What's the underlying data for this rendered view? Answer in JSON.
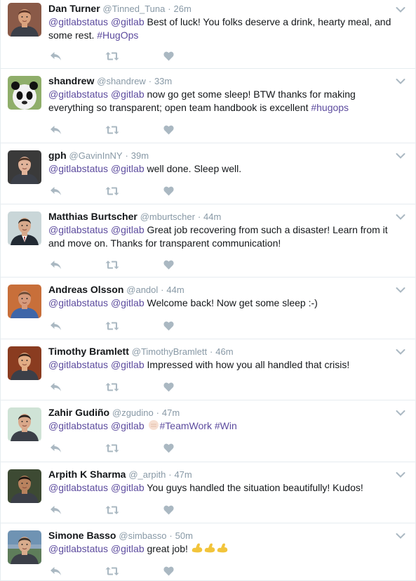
{
  "tweets": [
    {
      "name": "Dan Turner",
      "handle": "@Tinned_Tuna",
      "dot": "·",
      "time": "26m",
      "parts": [
        {
          "t": "mention",
          "v": "@gitlabstatus"
        },
        {
          "t": "text",
          "v": " "
        },
        {
          "t": "mention",
          "v": "@gitlab"
        },
        {
          "t": "text",
          "v": " Best of luck! You folks deserve a drink, hearty meal, and some rest. "
        },
        {
          "t": "hashtag",
          "v": "#HugOps"
        }
      ],
      "avatar": {
        "bg": "#8a5a48",
        "skin": "#d9a27e",
        "hair": "#5b3426"
      }
    },
    {
      "name": "shandrew",
      "handle": "@shandrew",
      "dot": "·",
      "time": "33m",
      "parts": [
        {
          "t": "mention",
          "v": "@gitlabstatus"
        },
        {
          "t": "text",
          "v": " "
        },
        {
          "t": "mention",
          "v": "@gitlab"
        },
        {
          "t": "text",
          "v": " now go get some sleep! BTW thanks for making everything so transparent; open team handbook is excellent "
        },
        {
          "t": "hashtag",
          "v": "#hugops"
        }
      ],
      "avatar": {
        "bg": "#8fae6a",
        "skin": "#f4f4f4",
        "hair": "#111111",
        "kind": "panda"
      }
    },
    {
      "name": "gph",
      "handle": "@GavinInNY",
      "dot": "·",
      "time": "39m",
      "parts": [
        {
          "t": "mention",
          "v": "@gitlabstatus"
        },
        {
          "t": "text",
          "v": " "
        },
        {
          "t": "mention",
          "v": "@gitlab"
        },
        {
          "t": "text",
          "v": " well done. Sleep well."
        }
      ],
      "avatar": {
        "bg": "#3a3a3a",
        "skin": "#e1b39a",
        "hair": "#4a3224"
      }
    },
    {
      "name": "Matthias Burtscher",
      "handle": "@mburtscher",
      "dot": "·",
      "time": "44m",
      "parts": [
        {
          "t": "mention",
          "v": "@gitlabstatus"
        },
        {
          "t": "text",
          "v": " "
        },
        {
          "t": "mention",
          "v": "@gitlab"
        },
        {
          "t": "text",
          "v": " Great job recovering from such a disaster! Learn from it and move on. Thanks for transparent communication!"
        }
      ],
      "avatar": {
        "bg": "#c9d6d8",
        "skin": "#d7a98b",
        "hair": "#2b2520",
        "kind": "suit"
      }
    },
    {
      "name": "Andreas Olsson",
      "handle": "@andol",
      "dot": "·",
      "time": "44m",
      "parts": [
        {
          "t": "mention",
          "v": "@gitlabstatus"
        },
        {
          "t": "text",
          "v": " "
        },
        {
          "t": "mention",
          "v": "@gitlab"
        },
        {
          "t": "text",
          "v": " Welcome back! Now get some sleep :-)"
        }
      ],
      "avatar": {
        "bg": "#c86f3a",
        "skin": "#d69a7c",
        "hair": "#6b4a34",
        "kind": "blueshirt"
      }
    },
    {
      "name": "Timothy Bramlett",
      "handle": "@TimothyBramlett",
      "dot": "·",
      "time": "46m",
      "parts": [
        {
          "t": "mention",
          "v": "@gitlabstatus"
        },
        {
          "t": "text",
          "v": " "
        },
        {
          "t": "mention",
          "v": "@gitlab"
        },
        {
          "t": "text",
          "v": " Impressed with how you all handled that crisis!"
        }
      ],
      "avatar": {
        "bg": "#8a3c20",
        "skin": "#e2ac84",
        "hair": "#3a2418"
      }
    },
    {
      "name": "Zahir Gudiño",
      "handle": "@zgudino",
      "dot": "·",
      "time": "47m",
      "parts": [
        {
          "t": "mention",
          "v": "@gitlabstatus"
        },
        {
          "t": "text",
          "v": " "
        },
        {
          "t": "mention",
          "v": "@gitlab"
        },
        {
          "t": "text",
          "v": " "
        },
        {
          "t": "emoji",
          "v": "fist"
        },
        {
          "t": "hashtag",
          "v": "#TeamWork"
        },
        {
          "t": "text",
          "v": " "
        },
        {
          "t": "hashtag",
          "v": "#Win"
        }
      ],
      "avatar": {
        "bg": "#cfe3d6",
        "skin": "#d9a88a",
        "hair": "#2a2220"
      }
    },
    {
      "name": "Arpith K Sharma",
      "handle": "@_arpith",
      "dot": "·",
      "time": "47m",
      "parts": [
        {
          "t": "mention",
          "v": "@gitlabstatus"
        },
        {
          "t": "text",
          "v": " "
        },
        {
          "t": "mention",
          "v": "@gitlab"
        },
        {
          "t": "text",
          "v": " You guys handled the situation beautifully! Kudos!"
        }
      ],
      "avatar": {
        "bg": "#3d4a33",
        "skin": "#b8825e",
        "hair": "#1a1410"
      }
    },
    {
      "name": "Simone Basso",
      "handle": "@simbasso",
      "dot": "·",
      "time": "50m",
      "parts": [
        {
          "t": "mention",
          "v": "@gitlabstatus"
        },
        {
          "t": "text",
          "v": " "
        },
        {
          "t": "mention",
          "v": "@gitlab"
        },
        {
          "t": "text",
          "v": " great job! "
        },
        {
          "t": "emoji",
          "v": "muscle"
        },
        {
          "t": "emoji",
          "v": "muscle"
        },
        {
          "t": "emoji",
          "v": "muscle"
        }
      ],
      "avatar": {
        "bg": "#6f93b3",
        "skin": "#d8ab8c",
        "hair": "#3a3028",
        "kind": "landscape"
      }
    }
  ],
  "icons": {
    "reply": "reply-icon",
    "retweet": "retweet-icon",
    "like": "heart-icon",
    "menu": "chevron-down-icon"
  },
  "colors": {
    "name": "#14171a",
    "meta": "#8899a6",
    "link": "#5c4b9e",
    "action": "#aab8c2",
    "divider": "#e6ecf0"
  }
}
